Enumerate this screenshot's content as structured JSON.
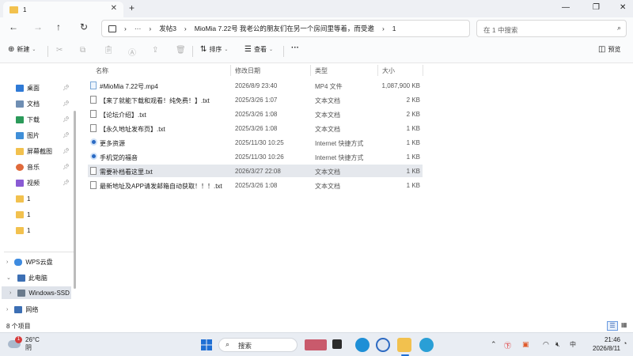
{
  "tab": {
    "title": "1"
  },
  "addressbar": {
    "crumbs": [
      "发帖3",
      "MioMia 7.22号 我老公的朋友们在另一个房间里等着，而受邀",
      "1"
    ],
    "ellipsis": "···",
    "search_placeholder": "在 1 中搜索"
  },
  "toolbar": {
    "new_label": "新建",
    "sort_label": "排序",
    "view_label": "查看",
    "more_label": "···",
    "preview_label": "预览"
  },
  "sidebar": {
    "pinned": [
      {
        "label": "桌面",
        "icon": "desktop-icon",
        "color": "#2f7ad6"
      },
      {
        "label": "文档",
        "icon": "documents-icon",
        "color": "#6f8eb3"
      },
      {
        "label": "下载",
        "icon": "downloads-icon",
        "color": "#2b9a5a"
      },
      {
        "label": "图片",
        "icon": "pictures-icon",
        "color": "#3f8fd8"
      },
      {
        "label": "屏幕截图",
        "icon": "folder-icon",
        "color": "#f2c14e"
      },
      {
        "label": "音乐",
        "icon": "music-icon",
        "color": "#e06a3b"
      },
      {
        "label": "视频",
        "icon": "videos-icon",
        "color": "#8a5bd4"
      }
    ],
    "folders": [
      {
        "label": "1",
        "icon": "folder-icon",
        "color": "#f2c14e"
      },
      {
        "label": "1",
        "icon": "folder-icon",
        "color": "#f2c14e"
      },
      {
        "label": "1",
        "icon": "folder-icon",
        "color": "#f2c14e"
      }
    ],
    "wps": "WPS云盘",
    "thispc": "此电脑",
    "drive": "Windows-SSD",
    "network": "网络"
  },
  "columns": {
    "name": "名称",
    "date": "修改日期",
    "type": "类型",
    "size": "大小"
  },
  "files": [
    {
      "name": "#MioMia 7.22号.mp4",
      "date": "2026/8/9 23:40",
      "type": "MP4 文件",
      "size": "1,087,900 KB",
      "kind": "mp4"
    },
    {
      "name": "【来了就能下载和观看！纯免费！】.txt",
      "date": "2025/3/26 1:07",
      "type": "文本文档",
      "size": "2 KB",
      "kind": "txt"
    },
    {
      "name": "【论坛介绍】.txt",
      "date": "2025/3/26 1:08",
      "type": "文本文档",
      "size": "2 KB",
      "kind": "txt"
    },
    {
      "name": "【永久地址发布页】.txt",
      "date": "2025/3/26 1:08",
      "type": "文本文档",
      "size": "1 KB",
      "kind": "txt"
    },
    {
      "name": "更多资源",
      "date": "2025/11/30 10:25",
      "type": "Internet 快捷方式",
      "size": "1 KB",
      "kind": "url"
    },
    {
      "name": "手机党的福音",
      "date": "2025/11/30 10:26",
      "type": "Internet 快捷方式",
      "size": "1 KB",
      "kind": "url"
    },
    {
      "name": "需要补档看这里.txt",
      "date": "2026/3/27 22:08",
      "type": "文本文档",
      "size": "1 KB",
      "kind": "txt",
      "selected": true
    },
    {
      "name": "最新地址及APP请发邮箱自动获取！！！.txt",
      "date": "2025/3/26 1:08",
      "type": "文本文档",
      "size": "1 KB",
      "kind": "txt"
    }
  ],
  "status": {
    "count": "8 个项目"
  },
  "taskbar": {
    "temp": "26°C",
    "cond": "阴",
    "badge": "1",
    "search": "搜索",
    "time": "21:46",
    "date": "2026/8/11",
    "ime": "中"
  }
}
